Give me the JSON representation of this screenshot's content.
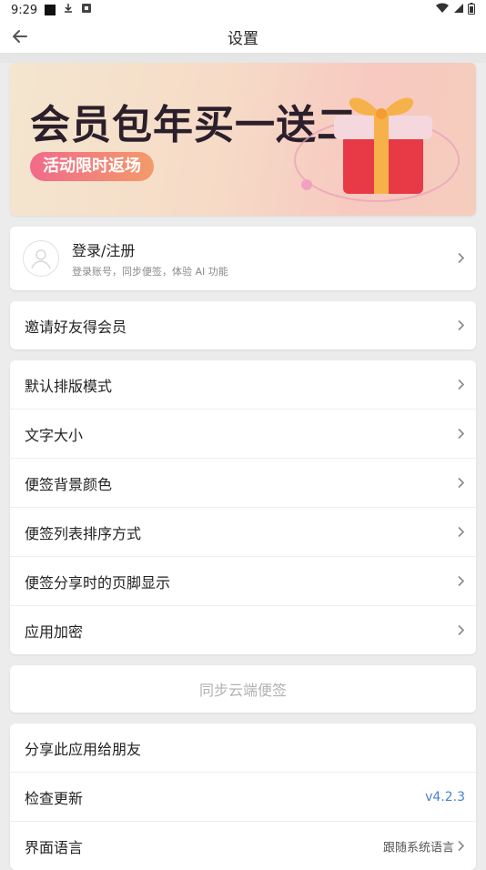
{
  "status": {
    "time": "9:29"
  },
  "header": {
    "title": "设置"
  },
  "banner": {
    "title": "会员包年买一送二",
    "pill": "活动限时返场"
  },
  "login": {
    "title": "登录/注册",
    "subtitle": "登录账号，同步便签，体验 AI 功能"
  },
  "invite": {
    "label": "邀请好友得会员"
  },
  "settings": [
    {
      "label": "默认排版模式"
    },
    {
      "label": "文字大小"
    },
    {
      "label": "便签背景颜色"
    },
    {
      "label": "便签列表排序方式"
    },
    {
      "label": "便签分享时的页脚显示"
    },
    {
      "label": "应用加密"
    }
  ],
  "sync": {
    "label": "同步云端便签"
  },
  "misc": {
    "share": "分享此应用给朋友",
    "update": "检查更新",
    "version": "v4.2.3",
    "language": "界面语言",
    "language_value": "跟随系统语言"
  },
  "colors": {
    "accent": "#4a7fd4",
    "background": "#ececec"
  }
}
